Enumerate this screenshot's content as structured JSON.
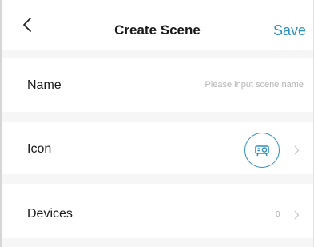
{
  "colors": {
    "accent": "#2b8fbf",
    "background": "#f6f6f6",
    "row": "#ffffff",
    "placeholder": "#b4b4b4"
  },
  "header": {
    "back_icon": "chevron-left-icon",
    "title": "Create Scene",
    "save_label": "Save"
  },
  "rows": {
    "name": {
      "label": "Name",
      "value": "",
      "placeholder": "Please input scene name"
    },
    "icon": {
      "label": "Icon",
      "icon": "projector-icon",
      "chevron": "chevron-right-icon"
    },
    "devices": {
      "label": "Devices",
      "count": "0",
      "chevron": "chevron-right-icon"
    }
  }
}
